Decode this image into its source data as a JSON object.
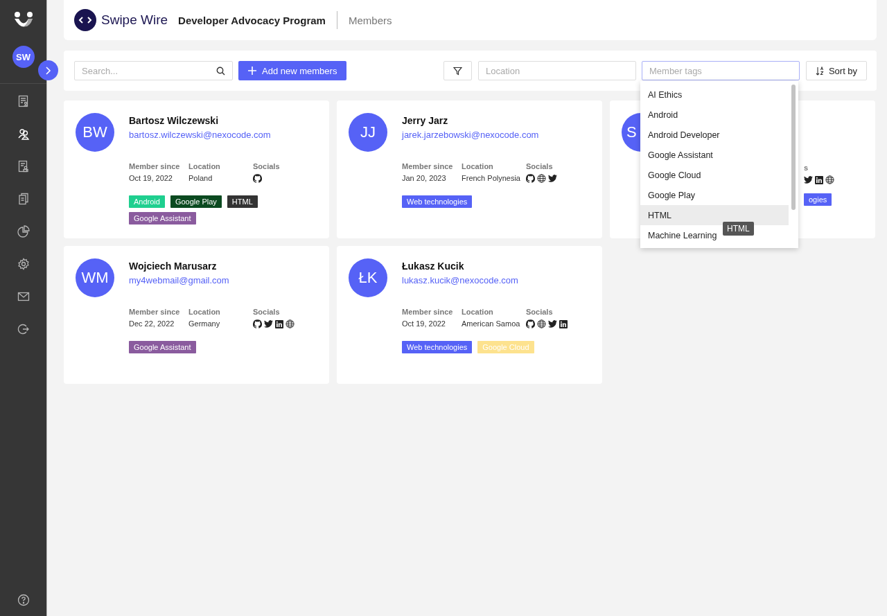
{
  "sidebar": {
    "avatar": "SW",
    "items": [
      {
        "kind": "report",
        "selected": false
      },
      {
        "kind": "people",
        "selected": true
      },
      {
        "kind": "badge-doc",
        "selected": false
      },
      {
        "kind": "clipboard",
        "selected": false
      },
      {
        "kind": "pie",
        "selected": false
      },
      {
        "kind": "gear",
        "selected": false
      },
      {
        "kind": "mail",
        "selected": false
      },
      {
        "kind": "logout",
        "selected": false
      }
    ]
  },
  "header": {
    "brand": "Swipe Wire",
    "program": "Developer Advocacy Program",
    "page": "Members"
  },
  "toolbar": {
    "search": {
      "placeholder": "Search..."
    },
    "add_button": "Add new members",
    "location": {
      "placeholder": "Location"
    },
    "tags": {
      "placeholder": "Member tags"
    },
    "sort_button": "Sort by"
  },
  "members": [
    {
      "kind": "full",
      "initials": "BW",
      "name": "Bartosz Wilczewski",
      "email": "bartosz.wilczewski@nexocode.com",
      "since_label": "Member since",
      "since": "Oct 19, 2022",
      "location_label": "Location",
      "location": "Poland",
      "socials_label": "Socials",
      "socials": [
        {
          "kind": "github"
        }
      ],
      "tags": [
        {
          "label": "Android",
          "color": "#1fcf8f"
        },
        {
          "label": "Google Play",
          "color": "#0b4a20"
        },
        {
          "label": "HTML",
          "color": "#333333"
        },
        {
          "label": "Google Assistant",
          "color": "#8a5b9e"
        }
      ]
    },
    {
      "kind": "full",
      "initials": "JJ",
      "name": "Jerry Jarz",
      "email": "jarek.jarzebowski@nexocode.com",
      "since_label": "Member since",
      "since": "Jan 20, 2023",
      "location_label": "Location",
      "location": "French Polynesia",
      "socials_label": "Socials",
      "socials": [
        {
          "kind": "github"
        },
        {
          "kind": "web"
        },
        {
          "kind": "twitter"
        }
      ],
      "tags": [
        {
          "label": "Web technologies",
          "color": "#5662f6"
        }
      ]
    },
    {
      "kind": "partial",
      "initials": "S",
      "socials_label": "s",
      "socials": [
        {
          "kind": "twitter"
        },
        {
          "kind": "linkedin"
        },
        {
          "kind": "web"
        }
      ],
      "tags": [
        {
          "label": "ogies",
          "color": "#5662f6"
        }
      ]
    },
    {
      "kind": "full",
      "initials": "WM",
      "name": "Wojciech Marusarz",
      "email": "my4webmail@gmail.com",
      "since_label": "Member since",
      "since": "Dec 22, 2022",
      "location_label": "Location",
      "location": "Germany",
      "socials_label": "Socials",
      "socials": [
        {
          "kind": "github"
        },
        {
          "kind": "twitter"
        },
        {
          "kind": "linkedin"
        },
        {
          "kind": "web"
        }
      ],
      "tags": [
        {
          "label": "Google Assistant",
          "color": "#8a5b9e"
        }
      ]
    },
    {
      "kind": "full",
      "initials": "ŁK",
      "name": "Łukasz Kucik",
      "email": "lukasz.kucik@nexocode.com",
      "since_label": "Member since",
      "since": "Oct 19, 2022",
      "location_label": "Location",
      "location": "American Samoa",
      "socials_label": "Socials",
      "socials": [
        {
          "kind": "github"
        },
        {
          "kind": "web"
        },
        {
          "kind": "twitter"
        },
        {
          "kind": "linkedin"
        }
      ],
      "tags": [
        {
          "label": "Web technologies",
          "color": "#5662f6"
        },
        {
          "label": "Google Cloud",
          "color": "#fde28e"
        }
      ]
    }
  ],
  "tag_dropdown": {
    "options": [
      {
        "label": "AI Ethics",
        "selected": false
      },
      {
        "label": "Android",
        "selected": false
      },
      {
        "label": "Android Developer",
        "selected": false
      },
      {
        "label": "Google Assistant",
        "selected": false
      },
      {
        "label": "Google Cloud",
        "selected": false
      },
      {
        "label": "Google Play",
        "selected": false
      },
      {
        "label": "HTML",
        "selected": true
      },
      {
        "label": "Machine Learning",
        "selected": false
      }
    ],
    "tooltip": "HTML"
  }
}
